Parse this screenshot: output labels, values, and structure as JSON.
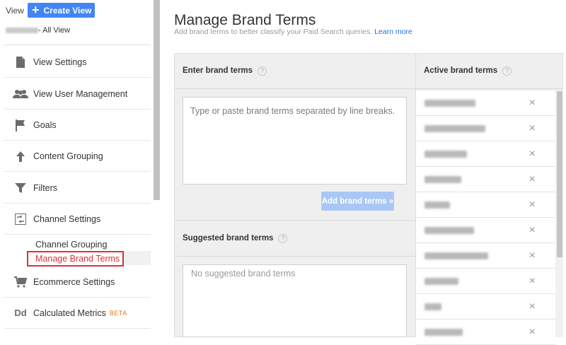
{
  "sidebar": {
    "view_label": "View",
    "create_view_label": "Create View",
    "view_name_suffix": "- All View",
    "items": [
      {
        "label": "View Settings",
        "icon": "document-icon"
      },
      {
        "label": "View User Management",
        "icon": "people-icon"
      },
      {
        "label": "Goals",
        "icon": "flag-icon"
      },
      {
        "label": "Content Grouping",
        "icon": "person-walk-icon"
      },
      {
        "label": "Filters",
        "icon": "filter-icon"
      },
      {
        "label": "Channel Settings",
        "icon": "channel-settings-icon"
      },
      {
        "label": "Ecommerce Settings",
        "icon": "cart-icon"
      },
      {
        "label": "Calculated Metrics",
        "icon": "dd-icon",
        "badge": "BETA",
        "icon_text": "Dd"
      }
    ],
    "sub_items": [
      {
        "label": "Channel Grouping"
      },
      {
        "label": "Manage Brand Terms",
        "active": true
      }
    ]
  },
  "main": {
    "title": "Manage Brand Terms",
    "subtitle": "Add brand terms to better classify your Paid Search queries.",
    "learn_more": "Learn more",
    "enter_header": "Enter brand terms",
    "terms_placeholder": "Type or paste brand terms separated by line breaks.",
    "add_button": "Add brand terms »",
    "suggested_header": "Suggested brand terms",
    "suggested_empty": "No suggested brand terms",
    "active_header": "Active brand terms",
    "remove_glyph": "×",
    "help_glyph": "?"
  },
  "colors": {
    "accent": "#4285f4",
    "active_red": "#db3236",
    "beta_orange": "#e8710a",
    "link_blue": "#1a73e8"
  }
}
